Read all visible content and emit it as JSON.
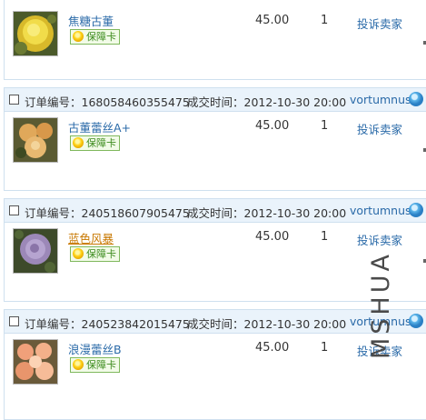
{
  "labels": {
    "order_no_prefix": "订单编号：",
    "deal_time_prefix": "成交时间：",
    "guarantee": "保障卡",
    "complain": "投诉卖家"
  },
  "orders": [
    {
      "show_header": false,
      "item": {
        "name": "焦糖古董",
        "price": "45.00",
        "qty": "1",
        "highlighted": false
      }
    },
    {
      "show_header": true,
      "order_no": "168058460355475",
      "deal_time": "2012-10-30 20:00",
      "seller": "vortumnus",
      "item": {
        "name": "古董蕾丝A+",
        "price": "45.00",
        "qty": "1",
        "highlighted": false
      }
    },
    {
      "show_header": true,
      "order_no": "240518607905475",
      "deal_time": "2012-10-30 20:00",
      "seller": "vortumnus",
      "item": {
        "name": "蓝色风暴",
        "price": "45.00",
        "qty": "1",
        "highlighted": true
      }
    },
    {
      "show_header": true,
      "order_no": "240523842015475",
      "deal_time": "2012-10-30 20:00",
      "seller": "vortumnus",
      "item": {
        "name": "浪漫蕾丝B",
        "price": "45.00",
        "qty": "1",
        "highlighted": false
      }
    }
  ],
  "watermark": "MSHUA",
  "colors": {
    "header_bg": "#eaf3fb",
    "border": "#cfe0ef",
    "link": "#2a6aa8",
    "highlight": "#c87800",
    "badge_green": "#3d8c1e"
  }
}
